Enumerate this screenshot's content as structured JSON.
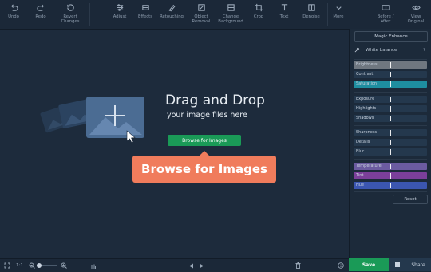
{
  "toolbar": {
    "left": [
      {
        "label": "Undo",
        "icon": "undo-icon"
      },
      {
        "label": "Redo",
        "icon": "redo-icon"
      },
      {
        "label": "Revert\nChanges",
        "icon": "revert-icon"
      }
    ],
    "tools": [
      {
        "label": "Adjust",
        "icon": "sliders-icon"
      },
      {
        "label": "Effects",
        "icon": "effects-icon"
      },
      {
        "label": "Retouching",
        "icon": "brush-icon"
      },
      {
        "label": "Object\nRemoval",
        "icon": "eraser-icon"
      },
      {
        "label": "Change\nBackground",
        "icon": "background-icon"
      },
      {
        "label": "Crop",
        "icon": "crop-icon"
      },
      {
        "label": "Text",
        "icon": "text-icon"
      },
      {
        "label": "Denoise",
        "icon": "denoise-icon"
      },
      {
        "label": "More",
        "icon": "more-icon"
      }
    ],
    "right": [
      {
        "label": "Before /\nAfter",
        "icon": "before-after-icon"
      },
      {
        "label": "View\nOriginal",
        "icon": "eye-icon"
      }
    ]
  },
  "canvas": {
    "title": "Drag and Drop",
    "subtitle": "your image files here",
    "browse_button": "Browse for Images",
    "callout": "Browse for Images"
  },
  "panel": {
    "magic_enhance": "Magic Enhance",
    "white_balance": "White balance",
    "help": "?",
    "sliders": [
      {
        "label": "Brightness",
        "color": "#6f7780",
        "level": 0.5
      },
      {
        "label": "Contrast",
        "color": "#24384d",
        "level": 0.5
      },
      {
        "label": "Saturation",
        "color": "#1e8ea0",
        "level": 0.5
      },
      {
        "label": "Exposure",
        "color": "#24384d",
        "level": 0.5
      },
      {
        "label": "Highlights",
        "color": "#24384d",
        "level": 0.5
      },
      {
        "label": "Shadows",
        "color": "#24384d",
        "level": 0.5
      },
      {
        "label": "Sharpness",
        "color": "#24384d",
        "level": 0.5
      },
      {
        "label": "Details",
        "color": "#24384d",
        "level": 0.5
      },
      {
        "label": "Blur",
        "color": "#24384d",
        "level": 0.5
      },
      {
        "label": "Temperature",
        "color": "#6b5ba0",
        "level": 0.5
      },
      {
        "label": "Tint",
        "color": "#7b3f9a",
        "level": 0.5
      },
      {
        "label": "Hue",
        "color": "#3b56b0",
        "level": 0.5
      }
    ],
    "reset": "Reset"
  },
  "bottom": {
    "fit": "1:1",
    "save": "Save",
    "share": "Share"
  },
  "colors": {
    "accent_green": "#1a9a57",
    "callout": "#f07c5c",
    "bg": "#1d2b3c"
  }
}
